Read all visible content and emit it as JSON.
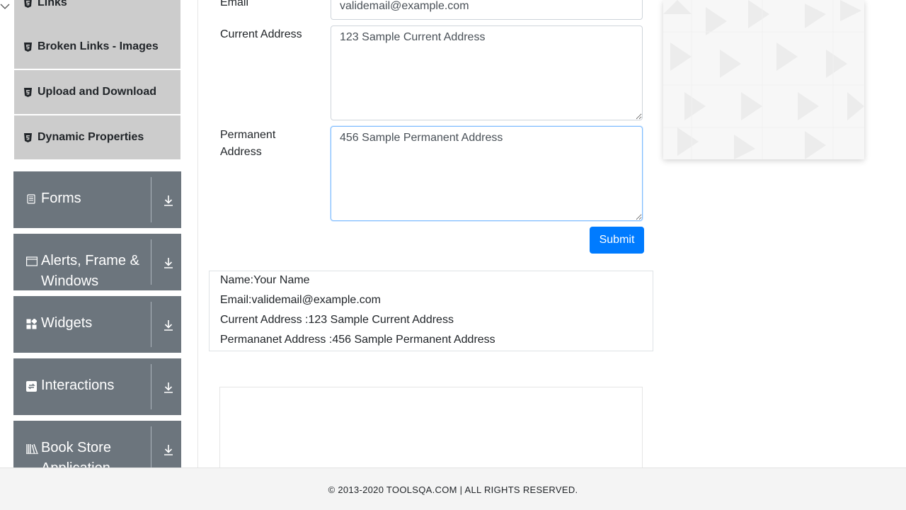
{
  "sidebar": {
    "sub_items": [
      {
        "label": "Links"
      },
      {
        "label": "Broken Links - Images"
      },
      {
        "label": "Upload and Download"
      },
      {
        "label": "Dynamic Properties"
      }
    ],
    "groups": [
      {
        "label": "Forms",
        "icon": "form-icon"
      },
      {
        "label": "Alerts, Frame & Windows",
        "icon": "window-icon"
      },
      {
        "label": "Widgets",
        "icon": "widgets-icon"
      },
      {
        "label": "Interactions",
        "icon": "interactions-icon"
      },
      {
        "label": "Book Store Application",
        "icon": "bookstore-icon"
      }
    ]
  },
  "form": {
    "email_label": "Email",
    "email_value": "validemail@example.com",
    "current_address_label": "Current Address",
    "current_address_value": "123 Sample Current Address",
    "permanent_address_label": "Permanent Address",
    "permanent_address_value": "456 Sample Permanent Address",
    "submit_label": "Submit"
  },
  "output": {
    "name": "Name:Your Name",
    "email": "Email:validemail@example.com",
    "current_address": "Current Address :123 Sample Current Address",
    "permanent_address": "Permananet Address :456 Sample Permanent Address"
  },
  "footer": {
    "copyright": "© 2013-2020 TOOLSQA.COM | ALL RIGHTS RESERVED."
  },
  "colors": {
    "primary": "#007bff",
    "group_bg": "#6c757d",
    "sub_item_bg": "#cccccc"
  }
}
